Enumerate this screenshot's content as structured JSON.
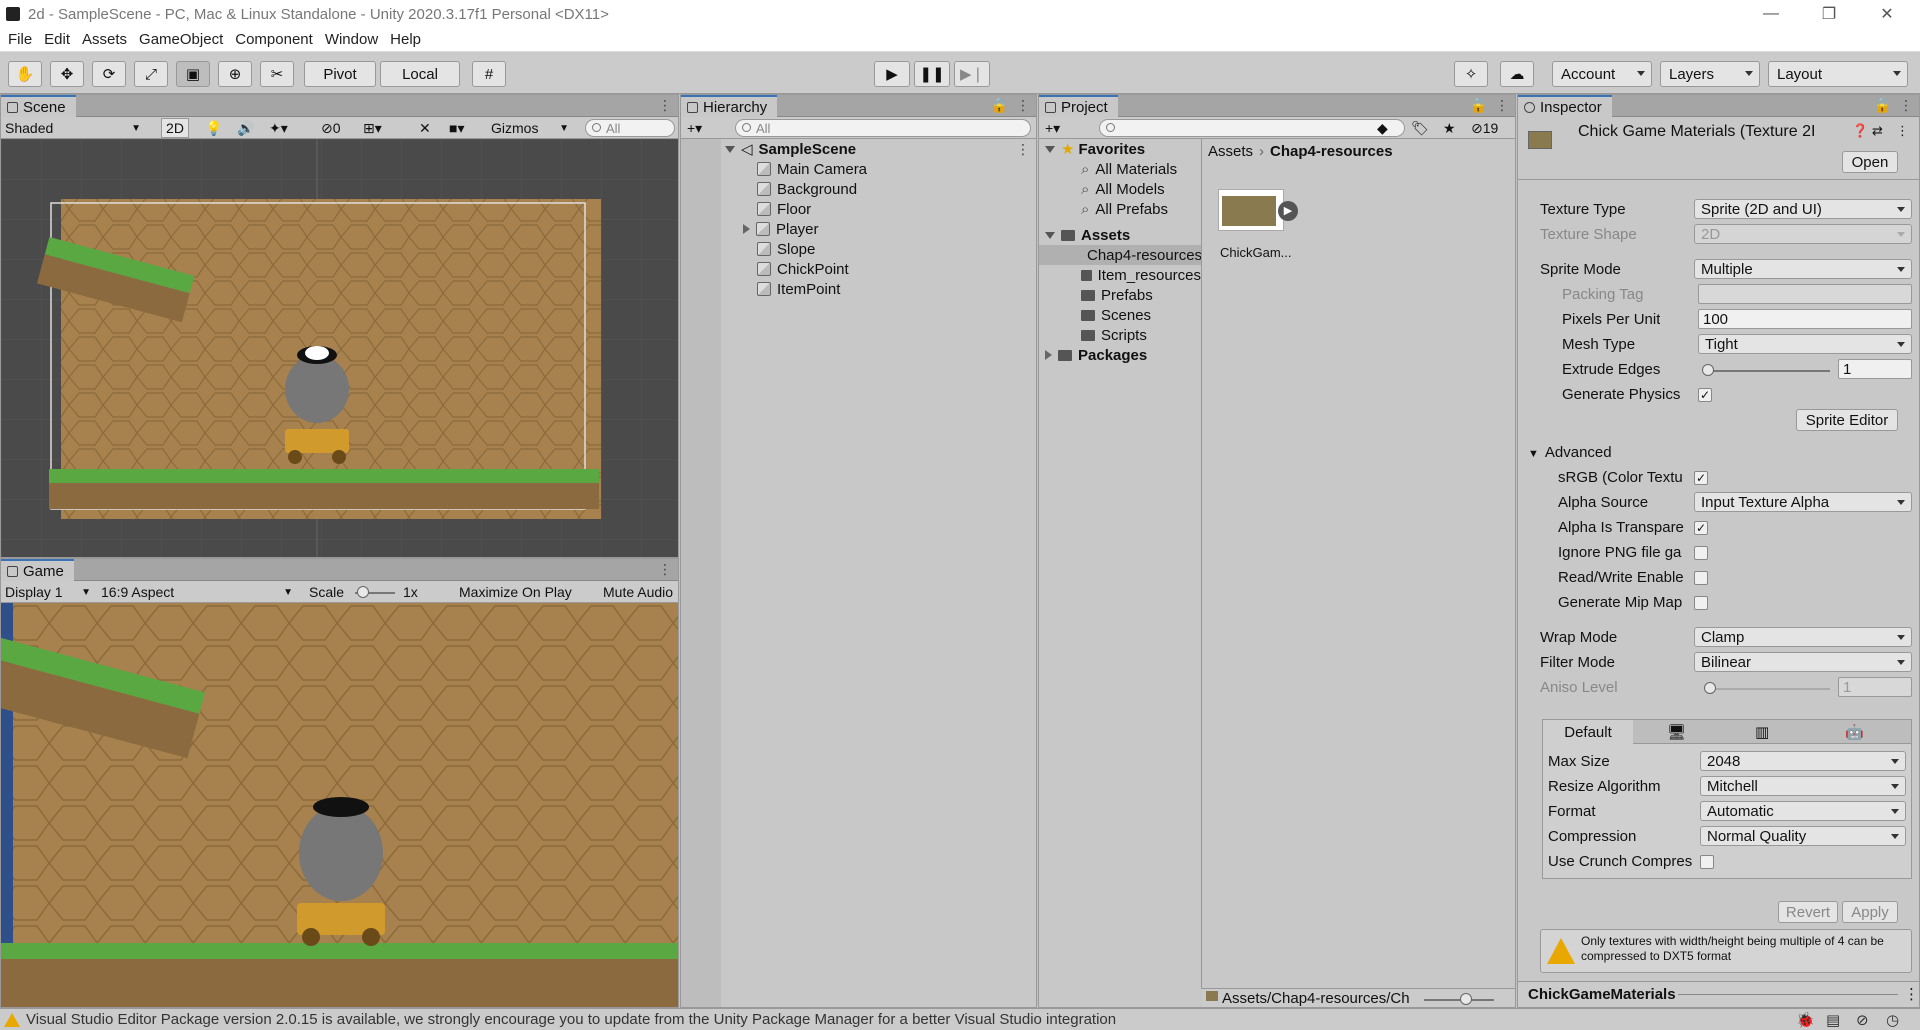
{
  "window": {
    "title": "2d - SampleScene - PC, Mac & Linux Standalone - Unity 2020.3.17f1 Personal <DX11>",
    "minimize": "—",
    "maximize": "❐",
    "close": "✕"
  },
  "menu": [
    "File",
    "Edit",
    "Assets",
    "GameObject",
    "Component",
    "Window",
    "Help"
  ],
  "toolbar": {
    "pivot": "Pivot",
    "local": "Local",
    "account": "Account",
    "layers": "Layers",
    "layout": "Layout"
  },
  "scene": {
    "tab": "Scene",
    "shading": "Shaded",
    "mode_2d": "2D",
    "hidden_count": "0",
    "gizmos": "Gizmos",
    "search_placeholder": "All"
  },
  "game": {
    "tab": "Game",
    "display": "Display 1",
    "aspect": "16:9 Aspect",
    "scale_label": "Scale",
    "scale_value": "1x",
    "maximize_on_play": "Maximize On Play",
    "mute_audio": "Mute Audio"
  },
  "hierarchy": {
    "tab": "Hierarchy",
    "search_placeholder": "All",
    "scene_name": "SampleScene",
    "items": [
      "Main Camera",
      "Background",
      "Floor",
      "Player",
      "Slope",
      "ChickPoint",
      "ItemPoint"
    ]
  },
  "project": {
    "tab": "Project",
    "hidden_count": "19",
    "favorites": "Favorites",
    "favorite_items": [
      "All Materials",
      "All Models",
      "All Prefabs"
    ],
    "assets": "Assets",
    "asset_folders": [
      "Chap4-resources",
      "Item_resources",
      "Prefabs",
      "Scenes",
      "Scripts"
    ],
    "packages": "Packages",
    "breadcrumb_root": "Assets",
    "breadcrumb_current": "Chap4-resources",
    "asset_tile_label": "ChickGam...",
    "footer_path": "Assets/Chap4-resources/Ch"
  },
  "inspector": {
    "tab": "Inspector",
    "asset_title": "Chick Game Materials (Texture 2I",
    "open_button": "Open",
    "texture_type_label": "Texture Type",
    "texture_type": "Sprite (2D and UI)",
    "texture_shape_label": "Texture Shape",
    "texture_shape": "2D",
    "sprite_mode_label": "Sprite Mode",
    "sprite_mode": "Multiple",
    "packing_tag_label": "Packing Tag",
    "packing_tag": "",
    "ppu_label": "Pixels Per Unit",
    "ppu": "100",
    "mesh_type_label": "Mesh Type",
    "mesh_type": "Tight",
    "extrude_label": "Extrude Edges",
    "extrude": "1",
    "gen_physics_label": "Generate Physics",
    "sprite_editor_button": "Sprite Editor",
    "advanced_label": "Advanced",
    "srgb_label": "sRGB (Color Textu",
    "alpha_source_label": "Alpha Source",
    "alpha_source": "Input Texture Alpha",
    "alpha_transparency_label": "Alpha Is Transpare",
    "ignore_png_label": "Ignore PNG file ga",
    "read_write_label": "Read/Write Enable",
    "gen_mip_label": "Generate Mip Map",
    "wrap_mode_label": "Wrap Mode",
    "wrap_mode": "Clamp",
    "filter_mode_label": "Filter Mode",
    "filter_mode": "Bilinear",
    "aniso_label": "Aniso Level",
    "aniso": "1",
    "platform_default": "Default",
    "max_size_label": "Max Size",
    "max_size": "2048",
    "resize_label": "Resize Algorithm",
    "resize": "Mitchell",
    "format_label": "Format",
    "format": "Automatic",
    "compression_label": "Compression",
    "compression": "Normal Quality",
    "crunch_label": "Use Crunch Compres",
    "revert_button": "Revert",
    "apply_button": "Apply",
    "warning": "Only textures with width/height being multiple of 4 can be compressed to DXT5 format",
    "footer_name": "ChickGameMaterials"
  },
  "status": {
    "message": "Visual Studio Editor Package version 2.0.15 is available, we strongly encourage you to update from the Unity Package Manager for a better Visual Studio integration"
  },
  "colors": {
    "accent": "#3a72b8",
    "sand": "#a8824e",
    "grass": "#5aa842",
    "warning": "#e8a800"
  }
}
